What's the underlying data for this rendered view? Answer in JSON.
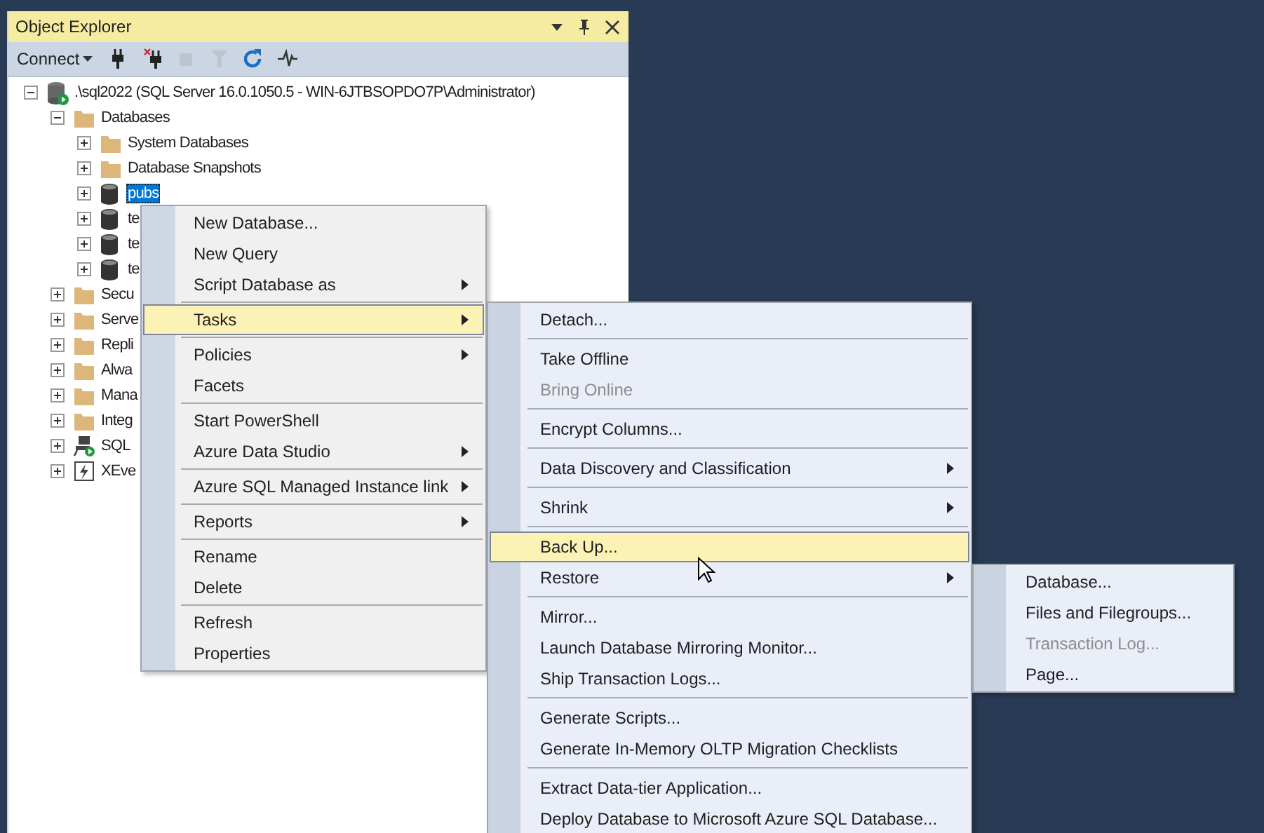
{
  "panel": {
    "title": "Object Explorer",
    "toolbar": {
      "connect": "Connect",
      "buttons": [
        {
          "kind": "connect",
          "disabled": false
        },
        {
          "kind": "disconnect",
          "disabled": false
        },
        {
          "kind": "stop",
          "disabled": true
        },
        {
          "kind": "filter",
          "disabled": true
        },
        {
          "kind": "refresh",
          "disabled": false
        },
        {
          "kind": "activity",
          "disabled": false
        }
      ]
    },
    "tree": [
      {
        "label": ".\\sql2022 (SQL Server 16.0.1050.5 - WIN-6JTBSOPDO7P\\Administrator)",
        "kind": "server",
        "expanded": true,
        "selected": false,
        "children": [
          {
            "label": "Databases",
            "kind": "folder",
            "expanded": true,
            "selected": false,
            "children": [
              {
                "label": "System Databases",
                "kind": "folder",
                "expanded": false,
                "selected": false
              },
              {
                "label": "Database Snapshots",
                "kind": "folder",
                "expanded": false,
                "selected": false
              },
              {
                "label": "pubs",
                "kind": "database",
                "expanded": false,
                "selected": true
              },
              {
                "label": "te",
                "kind": "database",
                "expanded": false,
                "selected": false
              },
              {
                "label": "te",
                "kind": "database",
                "expanded": false,
                "selected": false
              },
              {
                "label": "te",
                "kind": "database",
                "expanded": false,
                "selected": false
              }
            ]
          },
          {
            "label": "Secu",
            "kind": "folder",
            "expanded": false,
            "selected": false
          },
          {
            "label": "Serve",
            "kind": "folder",
            "expanded": false,
            "selected": false
          },
          {
            "label": "Repli",
            "kind": "folder",
            "expanded": false,
            "selected": false
          },
          {
            "label": "Alwa",
            "kind": "folder",
            "expanded": false,
            "selected": false
          },
          {
            "label": "Mana",
            "kind": "folder",
            "expanded": false,
            "selected": false
          },
          {
            "label": "Integ",
            "kind": "folder",
            "expanded": false,
            "selected": false
          },
          {
            "label": "SQL",
            "kind": "agent",
            "expanded": false,
            "selected": false
          },
          {
            "label": "XEve",
            "kind": "xevent",
            "expanded": false,
            "selected": false
          }
        ]
      }
    ]
  },
  "context_menu": {
    "items": [
      {
        "kind": "item",
        "label": "New Database...",
        "submenu": false,
        "disabled": false,
        "selected": false
      },
      {
        "kind": "item",
        "label": "New Query",
        "submenu": false,
        "disabled": false,
        "selected": false
      },
      {
        "kind": "item",
        "label": "Script Database as",
        "submenu": true,
        "disabled": false,
        "selected": false
      },
      {
        "kind": "separator"
      },
      {
        "kind": "item",
        "label": "Tasks",
        "submenu": true,
        "disabled": false,
        "selected": true
      },
      {
        "kind": "separator"
      },
      {
        "kind": "item",
        "label": "Policies",
        "submenu": true,
        "disabled": false,
        "selected": false
      },
      {
        "kind": "item",
        "label": "Facets",
        "submenu": false,
        "disabled": false,
        "selected": false
      },
      {
        "kind": "separator"
      },
      {
        "kind": "item",
        "label": "Start PowerShell",
        "submenu": false,
        "disabled": false,
        "selected": false
      },
      {
        "kind": "item",
        "label": "Azure Data Studio",
        "submenu": true,
        "disabled": false,
        "selected": false
      },
      {
        "kind": "separator"
      },
      {
        "kind": "item",
        "label": "Azure SQL Managed Instance link",
        "submenu": true,
        "disabled": false,
        "selected": false
      },
      {
        "kind": "separator"
      },
      {
        "kind": "item",
        "label": "Reports",
        "submenu": true,
        "disabled": false,
        "selected": false
      },
      {
        "kind": "separator"
      },
      {
        "kind": "item",
        "label": "Rename",
        "submenu": false,
        "disabled": false,
        "selected": false
      },
      {
        "kind": "item",
        "label": "Delete",
        "submenu": false,
        "disabled": false,
        "selected": false
      },
      {
        "kind": "separator"
      },
      {
        "kind": "item",
        "label": "Refresh",
        "submenu": false,
        "disabled": false,
        "selected": false
      },
      {
        "kind": "item",
        "label": "Properties",
        "submenu": false,
        "disabled": false,
        "selected": false
      }
    ]
  },
  "tasks_menu": {
    "items": [
      {
        "kind": "item",
        "label": "Detach...",
        "submenu": false,
        "disabled": false,
        "selected": false
      },
      {
        "kind": "separator"
      },
      {
        "kind": "item",
        "label": "Take Offline",
        "submenu": false,
        "disabled": false,
        "selected": false
      },
      {
        "kind": "item",
        "label": "Bring Online",
        "submenu": false,
        "disabled": true,
        "selected": false
      },
      {
        "kind": "separator"
      },
      {
        "kind": "item",
        "label": "Encrypt Columns...",
        "submenu": false,
        "disabled": false,
        "selected": false
      },
      {
        "kind": "separator"
      },
      {
        "kind": "item",
        "label": "Data Discovery and Classification",
        "submenu": true,
        "disabled": false,
        "selected": false
      },
      {
        "kind": "separator"
      },
      {
        "kind": "item",
        "label": "Shrink",
        "submenu": true,
        "disabled": false,
        "selected": false
      },
      {
        "kind": "separator"
      },
      {
        "kind": "item",
        "label": "Back Up...",
        "submenu": false,
        "disabled": false,
        "selected": true
      },
      {
        "kind": "item",
        "label": "Restore",
        "submenu": true,
        "disabled": false,
        "selected": false
      },
      {
        "kind": "separator"
      },
      {
        "kind": "item",
        "label": "Mirror...",
        "submenu": false,
        "disabled": false,
        "selected": false
      },
      {
        "kind": "item",
        "label": "Launch Database Mirroring Monitor...",
        "submenu": false,
        "disabled": false,
        "selected": false
      },
      {
        "kind": "item",
        "label": "Ship Transaction Logs...",
        "submenu": false,
        "disabled": false,
        "selected": false
      },
      {
        "kind": "separator"
      },
      {
        "kind": "item",
        "label": "Generate Scripts...",
        "submenu": false,
        "disabled": false,
        "selected": false
      },
      {
        "kind": "item",
        "label": "Generate In-Memory OLTP Migration Checklists",
        "submenu": false,
        "disabled": false,
        "selected": false
      },
      {
        "kind": "separator"
      },
      {
        "kind": "item",
        "label": "Extract Data-tier Application...",
        "submenu": false,
        "disabled": false,
        "selected": false
      },
      {
        "kind": "item",
        "label": "Deploy Database to Microsoft Azure SQL Database...",
        "submenu": false,
        "disabled": false,
        "selected": false
      }
    ]
  },
  "restore_menu": {
    "items": [
      {
        "kind": "item",
        "label": "Database...",
        "submenu": false,
        "disabled": false,
        "selected": false
      },
      {
        "kind": "item",
        "label": "Files and Filegroups...",
        "submenu": false,
        "disabled": false,
        "selected": false
      },
      {
        "kind": "item",
        "label": "Transaction Log...",
        "submenu": false,
        "disabled": true,
        "selected": false
      },
      {
        "kind": "item",
        "label": "Page...",
        "submenu": false,
        "disabled": false,
        "selected": false
      }
    ]
  }
}
